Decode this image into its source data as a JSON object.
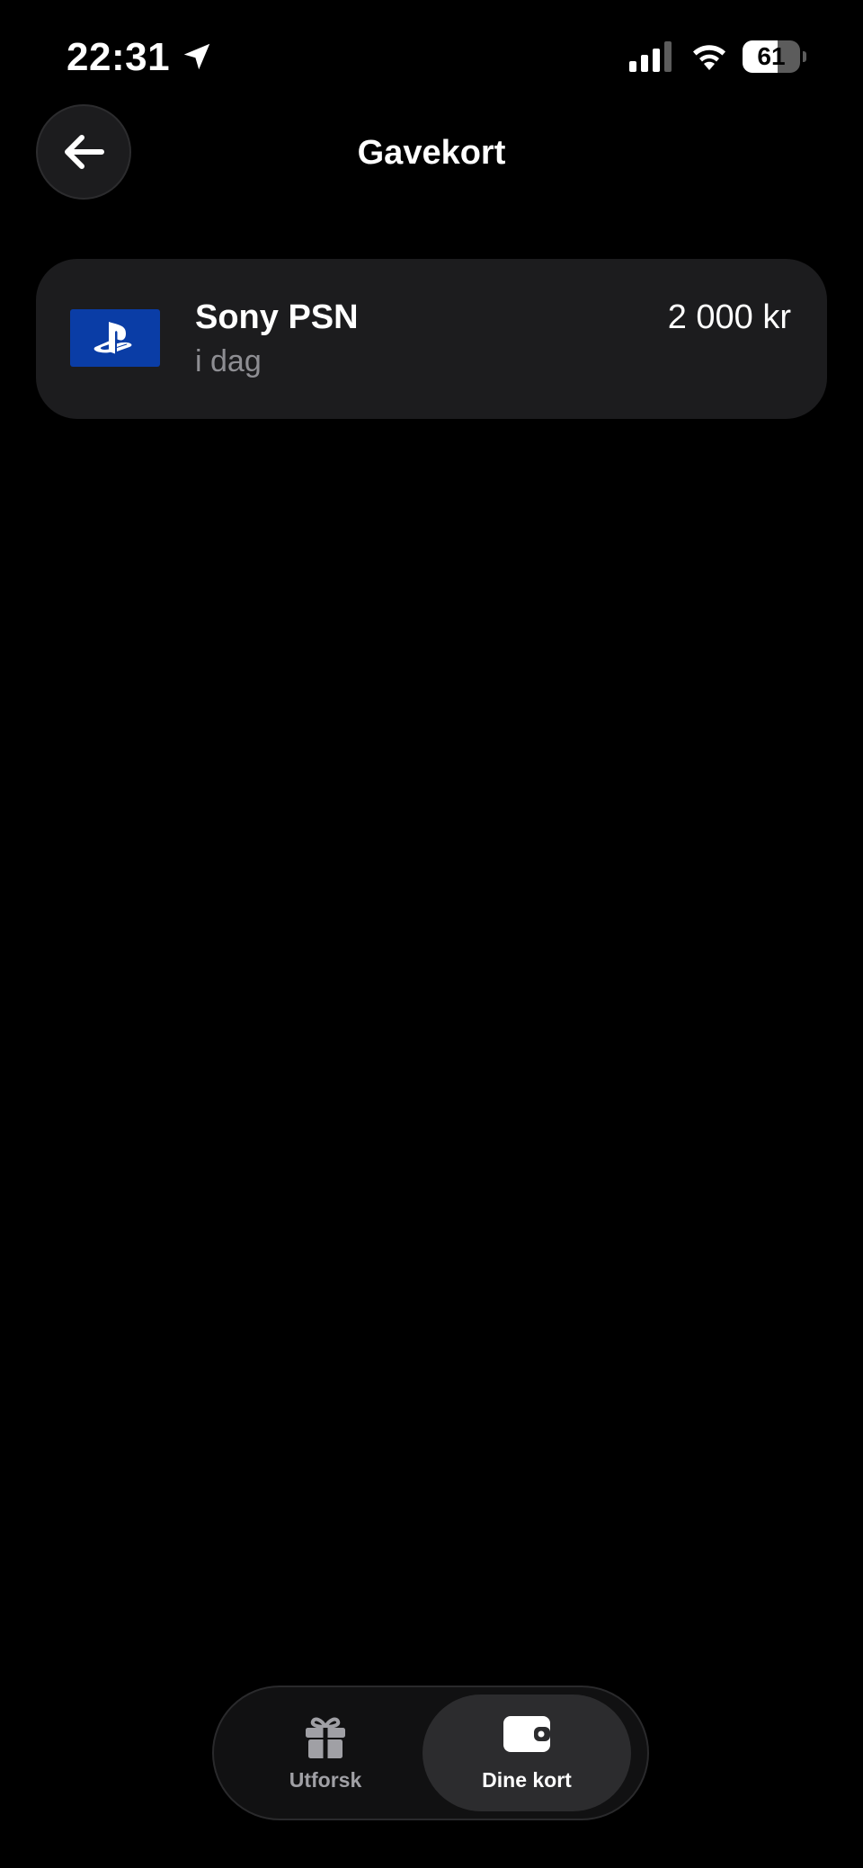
{
  "status_bar": {
    "time": "22:31",
    "battery_level": "61",
    "battery_fraction": 0.61,
    "icons": [
      "location-icon",
      "cellular-signal-icon",
      "wifi-icon",
      "battery-icon"
    ]
  },
  "header": {
    "title": "Gavekort",
    "back_icon": "arrow-left-icon"
  },
  "gift_cards": [
    {
      "name": "Sony PSN",
      "date": "i dag",
      "amount": "2 000 kr",
      "logo": "playstation-logo",
      "brand_color": "#0a3da6"
    }
  ],
  "tab_bar": {
    "tabs": [
      {
        "label": "Utforsk",
        "icon": "gift-icon",
        "active": false
      },
      {
        "label": "Dine kort",
        "icon": "wallet-icon",
        "active": true
      }
    ]
  },
  "colors": {
    "background": "#000000",
    "surface": "#1c1c1e",
    "secondary_text": "#8e8e93",
    "active_tab": "#2c2c2e"
  }
}
